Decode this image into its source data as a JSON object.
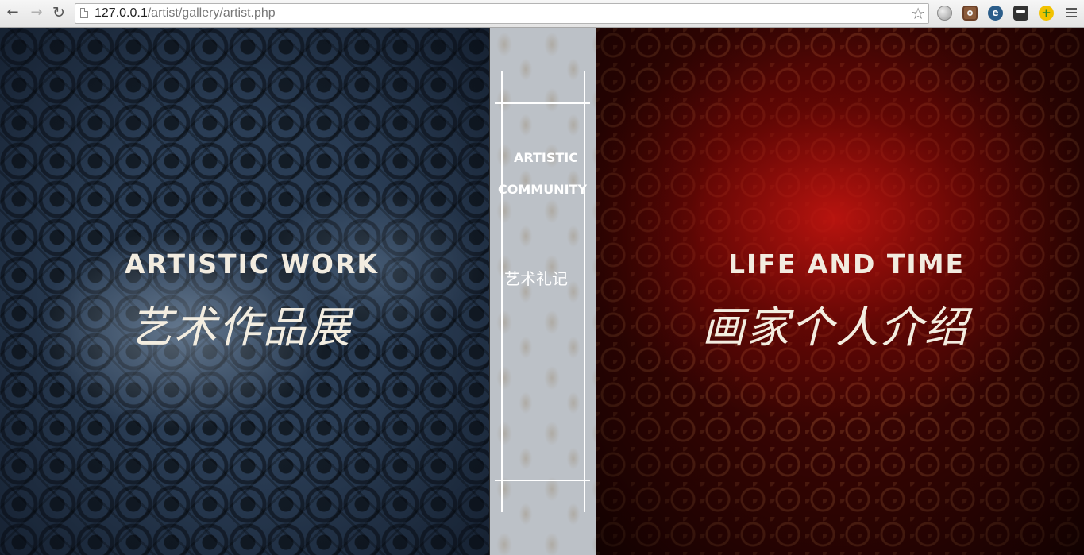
{
  "browser": {
    "url_host": "127.0.0.1",
    "url_path": "/artist/gallery/artist.php",
    "icons": {
      "back": "back-arrow-icon",
      "forward": "forward-arrow-icon",
      "reload": "reload-icon",
      "bookmark": "star-icon",
      "menu": "hamburger-menu-icon"
    }
  },
  "left_panel": {
    "title_en": "ARTISTIC WORK",
    "title_cn": "艺术作品展"
  },
  "middle_panel": {
    "line1": "ARTISTIC",
    "line2": "COMMUNITY",
    "title_cn": "艺术礼记"
  },
  "right_panel": {
    "title_en": "LIFE AND TIME",
    "title_cn": "画家个人介绍"
  },
  "colors": {
    "left_bg": "#2a3d55",
    "middle_bg": "#bcc1c7",
    "right_bg": "#8a0a06",
    "title_text": "#f2ece0"
  }
}
